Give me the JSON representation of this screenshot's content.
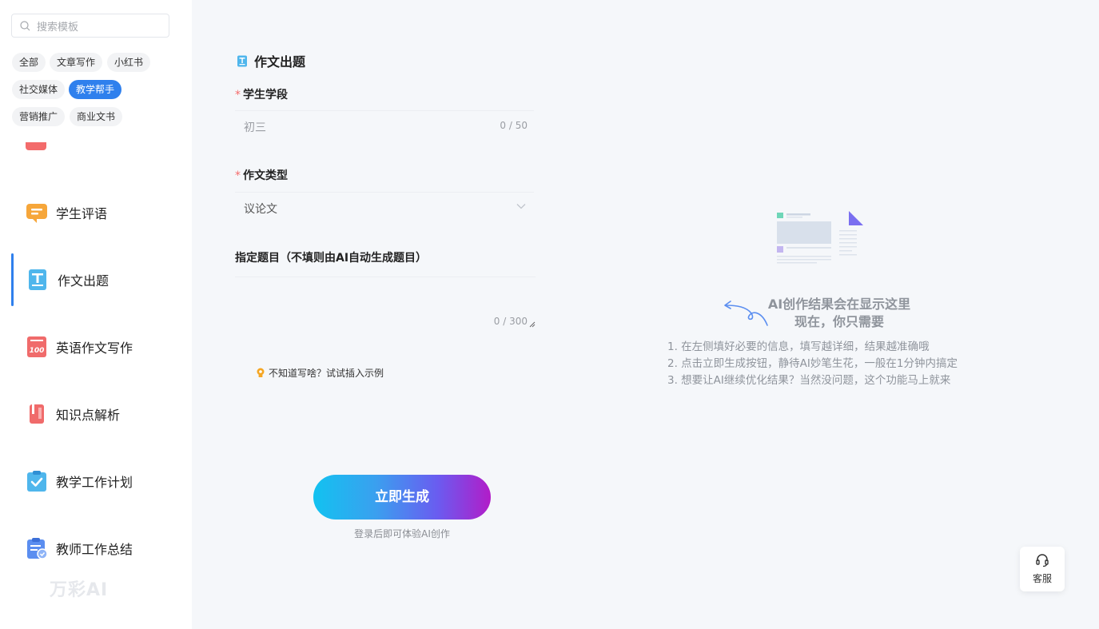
{
  "search": {
    "placeholder": "搜索模板"
  },
  "tags": [
    {
      "label": "全部",
      "active": false
    },
    {
      "label": "文章写作",
      "active": false
    },
    {
      "label": "小红书",
      "active": false
    },
    {
      "label": "社交媒体",
      "active": false
    },
    {
      "label": "教学帮手",
      "active": true
    },
    {
      "label": "营销推广",
      "active": false
    },
    {
      "label": "商业文书",
      "active": false
    }
  ],
  "tools": [
    {
      "label": "学生评语",
      "icon": "comment-icon"
    },
    {
      "label": "作文出题",
      "icon": "essay-icon",
      "active": true
    },
    {
      "label": "英语作文写作",
      "icon": "score-100-icon"
    },
    {
      "label": "知识点解析",
      "icon": "notebook-icon"
    },
    {
      "label": "教学工作计划",
      "icon": "checklist-icon"
    },
    {
      "label": "教师工作总结",
      "icon": "summary-icon"
    }
  ],
  "logo": {
    "text": "万彩AI"
  },
  "form": {
    "title": "作文出题",
    "stage_label": "学生学段",
    "stage_placeholder": "初三",
    "stage_count": "0 / 50",
    "type_label": "作文类型",
    "type_value": "议论文",
    "topic_label": "指定题目（不填则由AI自动生成题目）",
    "topic_count": "0 / 300",
    "example_text": "不知道写啥？试试插入示例",
    "generate_label": "立即生成",
    "login_tip": "登录后即可体验AI创作"
  },
  "result": {
    "title_line1": "AI创作结果会在显示这里",
    "title_line2": "现在，你只需要",
    "tips": [
      "1. 在左侧填好必要的信息，填写越详细，结果越准确哦",
      "2. 点击立即生成按钮，静待AI妙笔生花，一般在1分钟内搞定",
      "3. 想要让AI继续优化结果？当然没问题，这个功能马上就来"
    ]
  },
  "service": {
    "label": "客服"
  },
  "colors": {
    "accent": "#2f80ed",
    "required": "#f56c6c"
  }
}
